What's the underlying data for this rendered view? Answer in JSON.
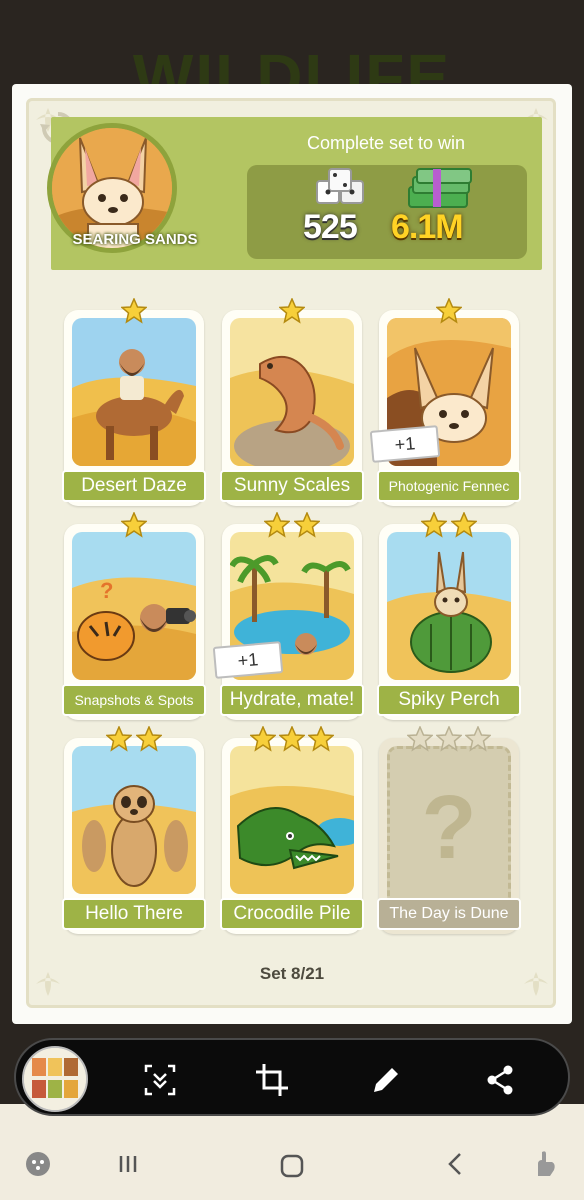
{
  "background_title": "WILDLIFE",
  "header": {
    "set_name": "SEARING SANDS",
    "reward_title": "Complete set to win",
    "dice_reward": "525",
    "cash_reward": "6.1M"
  },
  "cards": [
    {
      "label": "Desert Daze",
      "stars": 1
    },
    {
      "label": "Sunny Scales",
      "stars": 1
    },
    {
      "label": "Photogenic Fennec",
      "stars": 1,
      "badge": "+1"
    },
    {
      "label": "Snapshots & Spots",
      "stars": 1
    },
    {
      "label": "Hydrate, mate!",
      "stars": 2,
      "badge": "+1"
    },
    {
      "label": "Spiky Perch",
      "stars": 2
    },
    {
      "label": "Hello There",
      "stars": 2
    },
    {
      "label": "Crocodile Pile",
      "stars": 3
    },
    {
      "label": "The Day is Dune",
      "stars": 3,
      "locked": true,
      "placeholder": "?"
    }
  ],
  "set_counter": "Set 8/21",
  "toolbar": {
    "items": [
      "capture-icon",
      "crop-icon",
      "draw-icon",
      "share-icon"
    ]
  },
  "colors": {
    "header_green": "#b3c562",
    "label_green": "#9eb346",
    "locked_label": "#b8b096",
    "cash_gold": "#ffd325"
  }
}
